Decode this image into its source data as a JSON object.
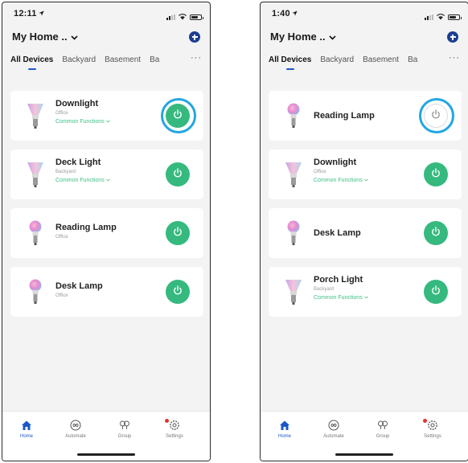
{
  "colors": {
    "accent_blue": "#1a57c8",
    "power_green": "#35b97e",
    "highlight_blue": "#22a7e0",
    "function_green": "#3cbf85"
  },
  "screens": [
    {
      "time": "12:11",
      "home_title": "My Home ..",
      "tabs": [
        "All Devices",
        "Backyard",
        "Basement",
        "Ba"
      ],
      "tab_more": "···",
      "devices": [
        {
          "name": "Downlight",
          "room": "Office",
          "functions": "Common Functions",
          "power": "on",
          "highlighted": true,
          "icon": "flood-bulb-icon"
        },
        {
          "name": "Deck Light",
          "room": "Backyard",
          "functions": "Common Functions",
          "power": "on",
          "highlighted": false,
          "icon": "flood-bulb-icon"
        },
        {
          "name": "Reading Lamp",
          "room": "Office",
          "functions": "",
          "power": "on",
          "highlighted": false,
          "icon": "a19-bulb-icon"
        },
        {
          "name": "Desk Lamp",
          "room": "Office",
          "functions": "",
          "power": "on",
          "highlighted": false,
          "icon": "a19-bulb-icon"
        }
      ],
      "nav": [
        "Home",
        "Automate",
        "Group",
        "Settings"
      ]
    },
    {
      "time": "1:40",
      "home_title": "My Home ..",
      "tabs": [
        "All Devices",
        "Backyard",
        "Basement",
        "Ba"
      ],
      "tab_more": "···",
      "devices": [
        {
          "name": "Reading Lamp",
          "room": "",
          "functions": "",
          "power": "off",
          "highlighted": true,
          "icon": "a19-bulb-icon"
        },
        {
          "name": "Downlight",
          "room": "Office",
          "functions": "Common Functions",
          "power": "on",
          "highlighted": false,
          "icon": "flood-bulb-icon"
        },
        {
          "name": "Desk Lamp",
          "room": "",
          "functions": "",
          "power": "on",
          "highlighted": false,
          "icon": "a19-bulb-icon"
        },
        {
          "name": "Porch Light",
          "room": "Backyard",
          "functions": "Common Functions",
          "power": "on",
          "highlighted": false,
          "icon": "flood-bulb-icon"
        }
      ],
      "nav": [
        "Home",
        "Automate",
        "Group",
        "Settings"
      ]
    }
  ]
}
